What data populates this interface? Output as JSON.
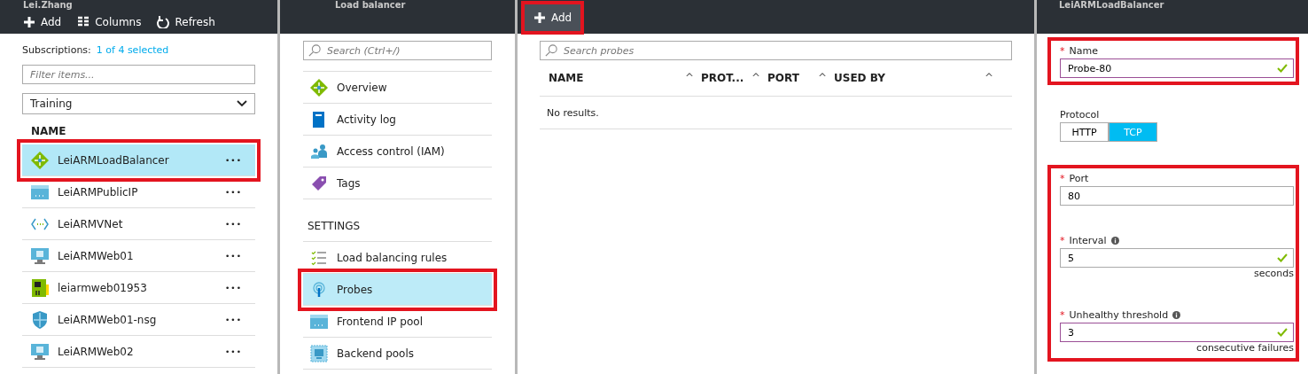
{
  "blades": [
    {
      "kind": "browse",
      "title": "Lei.Zhang",
      "toolbar": [
        {
          "kind": "add",
          "label": "Add"
        },
        {
          "kind": "columns",
          "label": "Columns"
        },
        {
          "kind": "refresh",
          "label": "Refresh"
        }
      ],
      "subscriptions_label": "Subscriptions:",
      "subscriptions_link": "1 of 4 selected",
      "filter": {
        "placeholder": "Filter items..."
      },
      "dropdown": {
        "value": "Training"
      },
      "column": "NAME",
      "rows": [
        {
          "kind": "loadbalancer",
          "name": "LeiARMLoadBalancer",
          "more": "•••",
          "selected": true,
          "highlighted": true
        },
        {
          "kind": "publicip",
          "name": "LeiARMPublicIP",
          "more": "•••",
          "selected": false,
          "highlighted": false
        },
        {
          "kind": "vnet",
          "name": "LeiARMVNet",
          "more": "•••",
          "selected": false,
          "highlighted": false
        },
        {
          "kind": "vm",
          "name": "LeiARMWeb01",
          "more": "•••",
          "selected": false,
          "highlighted": false
        },
        {
          "kind": "storage",
          "name": "leiarmweb01953",
          "more": "•••",
          "selected": false,
          "highlighted": false
        },
        {
          "kind": "nsg",
          "name": "LeiARMWeb01-nsg",
          "more": "•••",
          "selected": false,
          "highlighted": false
        },
        {
          "kind": "vm",
          "name": "LeiARMWeb02",
          "more": "•••",
          "selected": false,
          "highlighted": false
        }
      ]
    },
    {
      "kind": "menu",
      "title": "Load balancer",
      "search": {
        "placeholder": "Search (Ctrl+/)"
      },
      "sections": [
        {
          "items": [
            {
              "kind": "overview",
              "label": "Overview",
              "selected": false,
              "highlighted": false
            },
            {
              "kind": "log",
              "label": "Activity log",
              "selected": false,
              "highlighted": false
            },
            {
              "kind": "iam",
              "label": "Access control (IAM)",
              "selected": false,
              "highlighted": false
            },
            {
              "kind": "tags",
              "label": "Tags",
              "selected": false,
              "highlighted": false
            }
          ]
        },
        {
          "heading": "SETTINGS",
          "items": [
            {
              "kind": "rules",
              "label": "Load balancing rules",
              "selected": false,
              "highlighted": false
            },
            {
              "kind": "probes",
              "label": "Probes",
              "selected": true,
              "highlighted": true
            },
            {
              "kind": "frontend",
              "label": "Frontend IP pool",
              "selected": false,
              "highlighted": false
            },
            {
              "kind": "backend",
              "label": "Backend pools",
              "selected": false,
              "highlighted": false
            }
          ]
        }
      ]
    },
    {
      "kind": "list",
      "toolbar": [
        {
          "kind": "add",
          "label": "Add",
          "highlighted": true
        }
      ],
      "search": {
        "placeholder": "Search probes"
      },
      "columns": [
        "NAME",
        "PROT...",
        "PORT",
        "USED BY"
      ],
      "sort_icon": "^",
      "empty": "No results."
    },
    {
      "kind": "form",
      "title": "LeiARMLoadBalancer",
      "groups": [
        {
          "highlighted": true,
          "fields": [
            {
              "kind": "text",
              "required_mark": "*",
              "label": "Name",
              "info": false,
              "value": "Probe-80",
              "active": true,
              "valid": true
            }
          ]
        },
        {
          "highlighted": false,
          "fields": [
            {
              "kind": "toggle",
              "label": "Protocol",
              "options": [
                {
                  "label": "HTTP",
                  "selected": false
                },
                {
                  "label": "TCP",
                  "selected": true
                }
              ]
            }
          ]
        },
        {
          "highlighted": true,
          "fields": [
            {
              "kind": "text",
              "required_mark": "*",
              "label": "Port",
              "info": false,
              "value": "80",
              "active": false,
              "valid": false
            },
            {
              "kind": "text",
              "required_mark": "*",
              "label": "Interval",
              "info": true,
              "value": "5",
              "active": false,
              "valid": true,
              "unit": "seconds"
            },
            {
              "kind": "text",
              "required_mark": "*",
              "label": "Unhealthy threshold",
              "info": true,
              "value": "3",
              "active": true,
              "valid": true,
              "unit": "consecutive failures"
            }
          ]
        }
      ]
    }
  ]
}
